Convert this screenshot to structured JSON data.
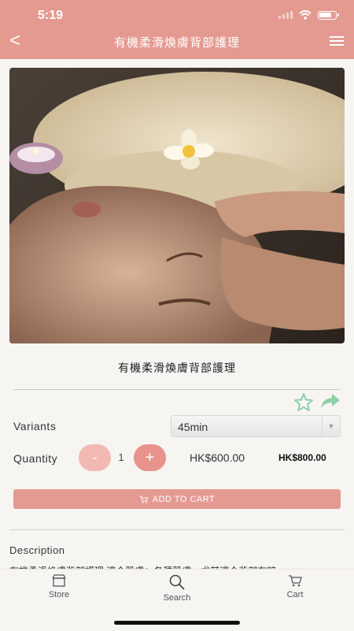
{
  "status": {
    "time": "5:19"
  },
  "header": {
    "back_label": "<",
    "title": "有機柔滑煥膚背部護理"
  },
  "hero_image": {
    "alt": "facial massage"
  },
  "product": {
    "name": "有機柔滑煥膚背部護理",
    "variants_label": "Variants",
    "selected_variant": "45min",
    "quantity_label": "Quantity",
    "quantity": "1",
    "minus_label": "-",
    "plus_label": "+",
    "price": "HK$600.00",
    "original_price": "HK$800.00",
    "add_to_cart_label": "ADD TO CART"
  },
  "description": {
    "title": "Description",
    "text": "有機柔滑煥膚背部護理 適合肌膚：各種肌膚，尤其適合背部有暗"
  },
  "tabs": [
    {
      "label": "Store",
      "icon": "store-icon"
    },
    {
      "label": "Search",
      "icon": "search-icon"
    },
    {
      "label": "Cart",
      "icon": "cart-icon"
    }
  ],
  "colors": {
    "accent": "#e59a91",
    "minus_button": "#f1b9b2",
    "plus_button": "#e8928c",
    "fav_star": "#8fcfa6",
    "share_arrow": "#8fcfa6"
  }
}
